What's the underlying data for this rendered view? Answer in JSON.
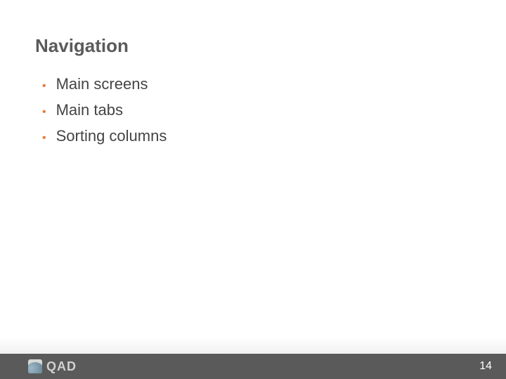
{
  "slide": {
    "title": "Navigation",
    "bullets": [
      "Main screens",
      "Main tabs",
      "Sorting columns"
    ]
  },
  "footer": {
    "logo_text": "QAD",
    "page_number": "14"
  }
}
